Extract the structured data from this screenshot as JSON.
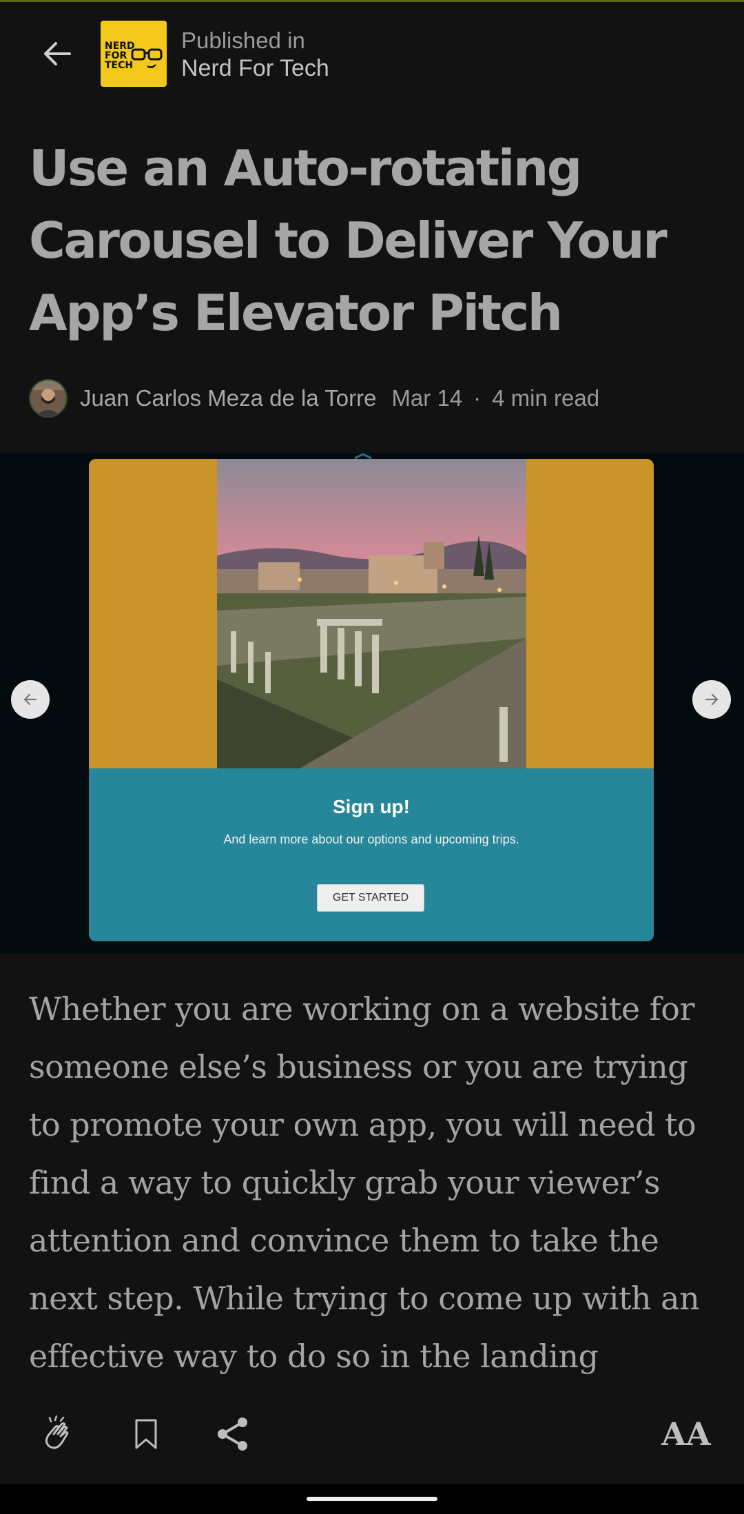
{
  "header": {
    "back_icon": "arrow-left-icon",
    "publication_logo_text": "NERD FOR TECH",
    "published_label": "Published in",
    "publication_name": "Nerd For Tech"
  },
  "article": {
    "title": "Use an Auto-rotating Carousel to Deliver Your App’s Elevator Pitch",
    "author": "Juan Carlos Meza de la Torre",
    "date": "Mar 14",
    "separator": "·",
    "read_time": "4 min read",
    "body": "Whether you are working on a website for someone else’s business or you are trying to promote your own app, you will need to find a way to quickly grab your viewer’s attention and convince them to take the next step. While trying to come up with an effective way to do so in the landing"
  },
  "hero": {
    "card_title": "Sign up!",
    "card_subtitle": "And learn more about our options and upcoming trips.",
    "card_button": "GET STARTED",
    "prev_icon": "arrow-left-icon",
    "next_icon": "arrow-right-icon"
  },
  "toolbar": {
    "clap_icon": "clap-icon",
    "bookmark_icon": "bookmark-icon",
    "share_icon": "share-icon",
    "text_size_label": "AA"
  },
  "colors": {
    "background": "#121212",
    "logo_yellow": "#f2c81b",
    "card_gold": "#c9952b",
    "card_teal": "#26869a"
  }
}
